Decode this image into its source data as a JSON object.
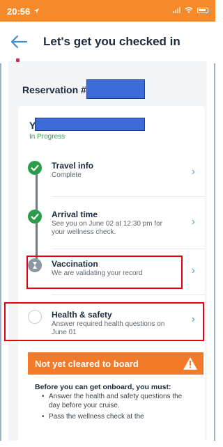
{
  "status_bar": {
    "time": "20:56",
    "location_icon": "location-arrow-icon",
    "signal_icon": "signal-bars-icon",
    "wifi_icon": "wifi-icon",
    "battery_icon": "battery-icon"
  },
  "header": {
    "back_icon": "back-arrow-icon",
    "title": "Let's get you checked in"
  },
  "reservation": {
    "label": "Reservation #"
  },
  "guest": {
    "name_initial": "Y",
    "status": "In Progress"
  },
  "steps": [
    {
      "title": "Travel info",
      "description": "Complete",
      "icon": "checkmark-icon",
      "state": "complete"
    },
    {
      "title": "Arrival time",
      "description": "See you on June 02 at 12:30 pm for your wellness check.",
      "icon": "checkmark-icon",
      "state": "complete"
    },
    {
      "title": "Vaccination",
      "description": "We are validating your record",
      "icon": "hourglass-icon",
      "state": "pending"
    },
    {
      "title": "Health & safety",
      "description": "Answer required health questions on June 01",
      "icon": "empty-circle-icon",
      "state": "not-started"
    }
  ],
  "chevron_icon": "chevron-right-icon",
  "alert": {
    "title": "Not yet cleared to board",
    "icon": "warning-triangle-icon",
    "intro": "Before you can get onboard, you must:",
    "items": [
      "Answer the health and safety questions the day before your cruise.",
      "Pass the wellness check at the"
    ]
  },
  "colors": {
    "brand_orange": "#f37a28",
    "success_green": "#2a9d4a",
    "link_blue": "#5aa5d8",
    "highlight_red": "#e3000f",
    "redaction_blue": "#3c6ad6"
  }
}
